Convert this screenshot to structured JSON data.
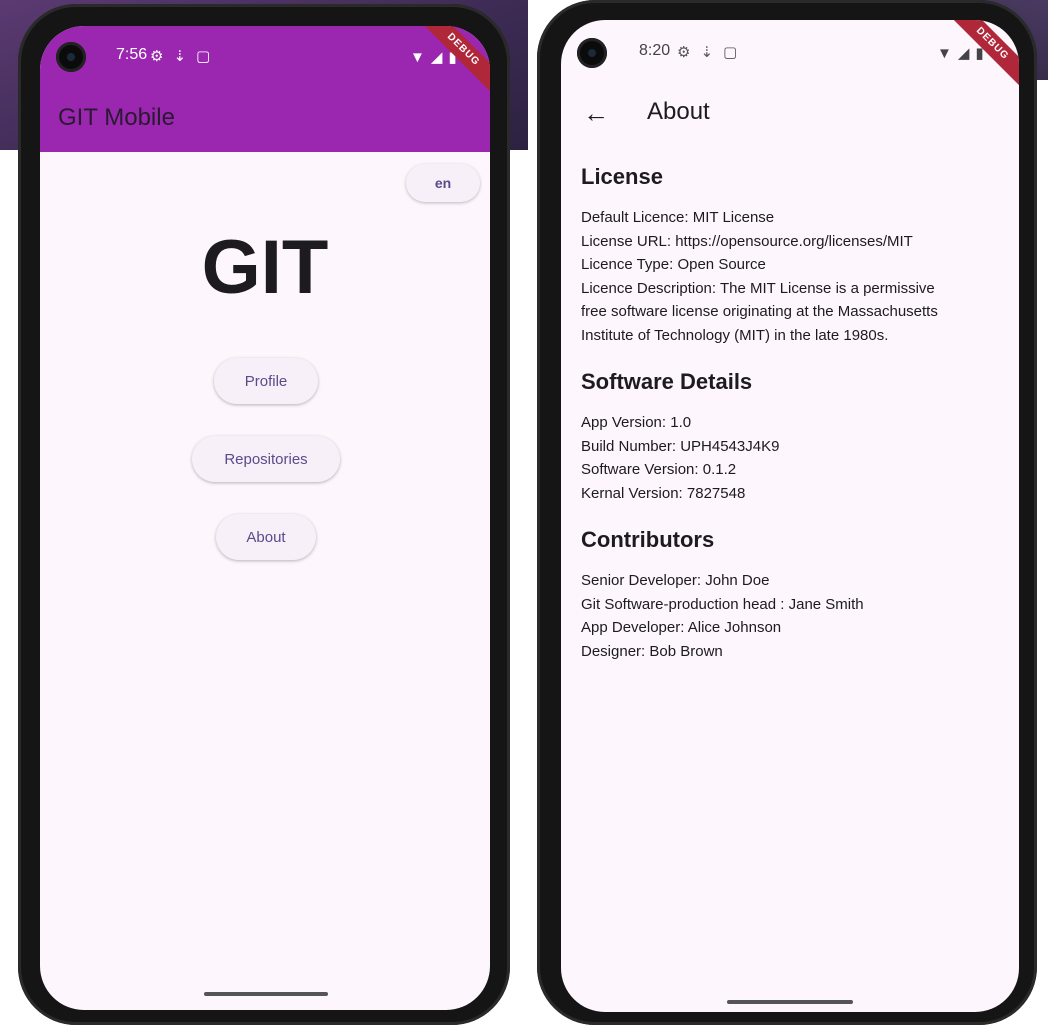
{
  "home_screen": {
    "status": {
      "time": "7:56",
      "debug": "DEBUG"
    },
    "app_title": "GIT Mobile",
    "language": "en",
    "logo_text": "GIT",
    "buttons": {
      "profile": "Profile",
      "repositories": "Repositories",
      "about": "About"
    },
    "colors": {
      "appbar": "#9b27b0",
      "background": "#fdf6fd",
      "button_text": "#5d4a8a"
    }
  },
  "about_screen": {
    "status": {
      "time": "8:20",
      "debug": "DEBUG"
    },
    "title": "About",
    "license": {
      "heading": "License",
      "lines": [
        "Default Licence: MIT License",
        "License URL: https://opensource.org/licenses/MIT",
        "Licence Type: Open Source",
        "Licence Description: The MIT License is a permissive",
        "free software license originating at the Massachusetts",
        "Institute of Technology (MIT) in the late 1980s."
      ]
    },
    "software": {
      "heading": "Software Details",
      "lines": [
        "App Version: 1.0",
        "Build Number: UPH4543J4K9",
        "Software Version: 0.1.2",
        "Kernal Version: 7827548"
      ]
    },
    "contributors": {
      "heading": "Contributors",
      "lines": [
        "Senior Developer: John Doe",
        "Git Software-production head : Jane Smith",
        "App Developer: Alice Johnson",
        "Designer: Bob Brown"
      ]
    }
  }
}
